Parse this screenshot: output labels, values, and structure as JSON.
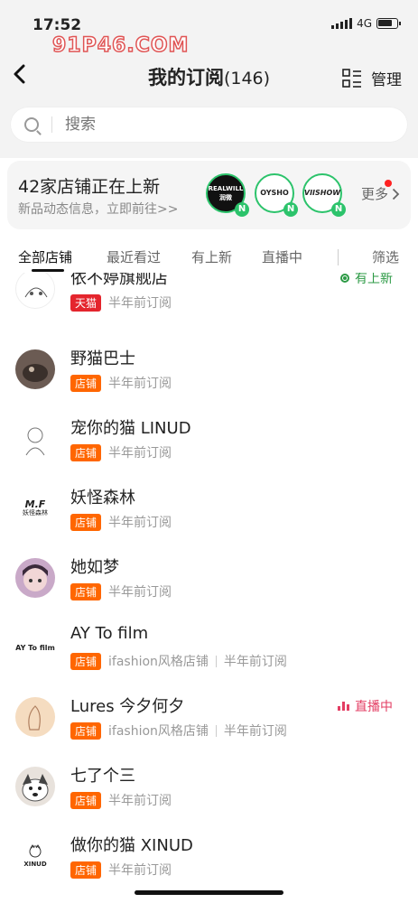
{
  "status_bar": {
    "time": "17:52",
    "network": "4G"
  },
  "watermark": "91P46.COM",
  "header": {
    "title": "我的订阅",
    "count": "(146)",
    "manage_label": "管理"
  },
  "search": {
    "placeholder": "搜索"
  },
  "updates_card": {
    "title": "42家店铺正在上新",
    "subtitle": "新品动态信息，立即前往>>",
    "more_label": "更多",
    "logos": [
      {
        "text": "REALWILL 润微",
        "badge": "N"
      },
      {
        "text": "OYSHO",
        "badge": "N"
      },
      {
        "text": "VIISHOW",
        "badge": "N"
      }
    ]
  },
  "tabs": [
    "全部店铺",
    "最近看过",
    "有上新",
    "直播中",
    "筛选"
  ],
  "shops": [
    {
      "name": "依不婷旗舰店",
      "badge": "天猫",
      "badge_type": "tmall",
      "category": "",
      "subscribed": "半年前订阅",
      "status": "有上新",
      "status_type": "new"
    },
    {
      "name": "野猫巴士",
      "badge": "店铺",
      "badge_type": "shop",
      "category": "",
      "subscribed": "半年前订阅",
      "status": "",
      "status_type": ""
    },
    {
      "name": "宠你的猫 LINUD",
      "badge": "店铺",
      "badge_type": "shop",
      "category": "",
      "subscribed": "半年前订阅",
      "status": "",
      "status_type": ""
    },
    {
      "name": "妖怪森林",
      "badge": "店铺",
      "badge_type": "shop",
      "category": "",
      "subscribed": "半年前订阅",
      "status": "",
      "status_type": ""
    },
    {
      "name": "她如梦",
      "badge": "店铺",
      "badge_type": "shop",
      "category": "",
      "subscribed": "半年前订阅",
      "status": "",
      "status_type": ""
    },
    {
      "name": "AY To film",
      "badge": "店铺",
      "badge_type": "shop",
      "category": "ifashion风格店铺",
      "subscribed": "半年前订阅",
      "status": "",
      "status_type": ""
    },
    {
      "name": "Lures 今夕何夕",
      "badge": "店铺",
      "badge_type": "shop",
      "category": "ifashion风格店铺",
      "subscribed": "半年前订阅",
      "status": "直播中",
      "status_type": "live"
    },
    {
      "name": "七了个三",
      "badge": "店铺",
      "badge_type": "shop",
      "category": "",
      "subscribed": "半年前订阅",
      "status": "",
      "status_type": ""
    },
    {
      "name": "做你的猫 XINUD",
      "badge": "店铺",
      "badge_type": "shop",
      "category": "",
      "subscribed": "半年前订阅",
      "status": "",
      "status_type": ""
    }
  ],
  "avatar_labels": {
    "ay": "AY To film",
    "mf": "M.F",
    "mf_sub": "妖怪森林",
    "xinud": "XINUD"
  },
  "colors": {
    "shop_badge": "#ff6600",
    "tmall_badge": "#e4252d",
    "new_green": "#2c9a45",
    "live_red": "#e33e63",
    "logo_ring": "#2cc36b"
  }
}
